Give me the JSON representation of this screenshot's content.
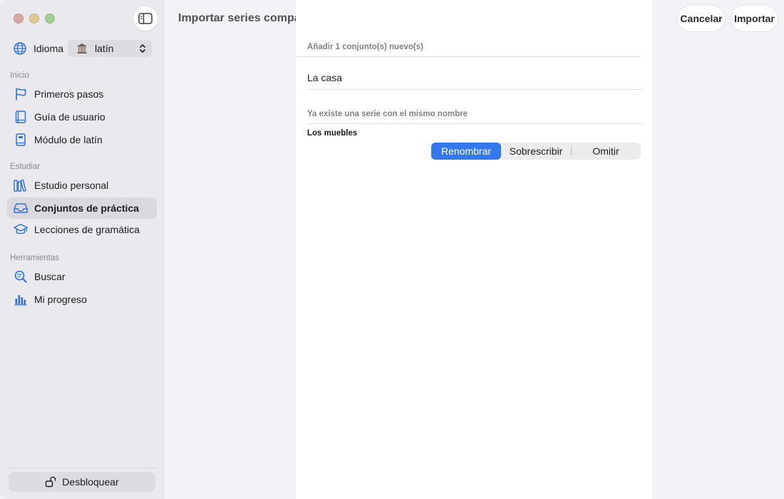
{
  "sidebar": {
    "language_label": "Idioma",
    "language_value": "latín",
    "sections": {
      "start": "Inicio",
      "study": "Estudiar",
      "tools": "Herramientas"
    },
    "items": [
      {
        "label": "Primeros pasos",
        "icon": "flag-icon"
      },
      {
        "label": "Guía de usuario",
        "icon": "book-icon"
      },
      {
        "label": "Módulo de latín",
        "icon": "module-book-icon"
      },
      {
        "label": "Estudio personal",
        "icon": "library-icon"
      },
      {
        "label": "Conjuntos de práctica",
        "icon": "tray-icon",
        "active": true
      },
      {
        "label": "Lecciones de gramática",
        "icon": "graduation-cap-icon"
      },
      {
        "label": "Buscar",
        "icon": "search-icon"
      },
      {
        "label": "Mi progreso",
        "icon": "bar-chart-icon"
      }
    ],
    "unlock_label": "Desbloquear"
  },
  "header": {
    "title": "Importar series compartidas",
    "cancel_label": "Cancelar",
    "import_label": "Importar"
  },
  "panel": {
    "new_sets_header": "Añadir 1 conjunto(s) nuevo(s)",
    "new_set_name": "La casa",
    "conflict_header": "Ya existe una serie con el mismo nombre",
    "conflict_set_name": "Los muebles",
    "options": [
      "Renombrar",
      "Sobrescribir",
      "Omitir"
    ],
    "selected_option": "Renombrar"
  },
  "colors": {
    "accent": "#3478f0",
    "icon_blue": "#2f6fe0",
    "sidebar_bg": "#e9e9ee"
  }
}
